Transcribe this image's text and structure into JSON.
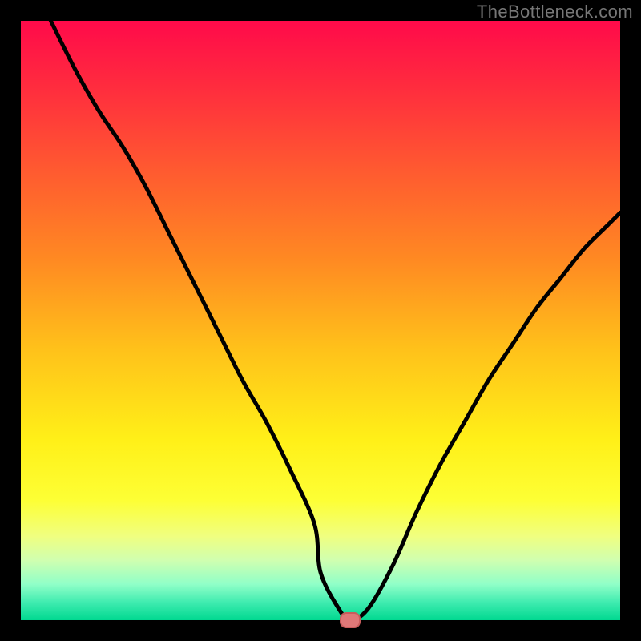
{
  "watermark": "TheBottleneck.com",
  "chart_data": {
    "type": "line",
    "title": "",
    "xlabel": "",
    "ylabel": "",
    "xlim": [
      0,
      100
    ],
    "ylim": [
      0,
      100
    ],
    "x": [
      5,
      9,
      13,
      17,
      21,
      25,
      29,
      33,
      37,
      41,
      45,
      49,
      50,
      53,
      55,
      58,
      62,
      66,
      70,
      74,
      78,
      82,
      86,
      90,
      94,
      98,
      100
    ],
    "values": [
      100,
      92,
      85,
      79,
      72,
      64,
      56,
      48,
      40,
      33,
      25,
      16,
      8,
      2,
      0,
      2,
      9,
      18,
      26,
      33,
      40,
      46,
      52,
      57,
      62,
      66,
      68
    ],
    "gradient_stops": [
      {
        "offset": 0.0,
        "color": "#ff0a4a"
      },
      {
        "offset": 0.12,
        "color": "#ff2f3d"
      },
      {
        "offset": 0.25,
        "color": "#ff5a30"
      },
      {
        "offset": 0.4,
        "color": "#ff8a22"
      },
      {
        "offset": 0.55,
        "color": "#ffc21a"
      },
      {
        "offset": 0.7,
        "color": "#fff018"
      },
      {
        "offset": 0.8,
        "color": "#fdff35"
      },
      {
        "offset": 0.86,
        "color": "#f0ff80"
      },
      {
        "offset": 0.9,
        "color": "#d0ffb0"
      },
      {
        "offset": 0.94,
        "color": "#90ffc8"
      },
      {
        "offset": 0.97,
        "color": "#40ecb0"
      },
      {
        "offset": 1.0,
        "color": "#00d890"
      }
    ],
    "marker": {
      "x": 55,
      "y": 0
    }
  }
}
